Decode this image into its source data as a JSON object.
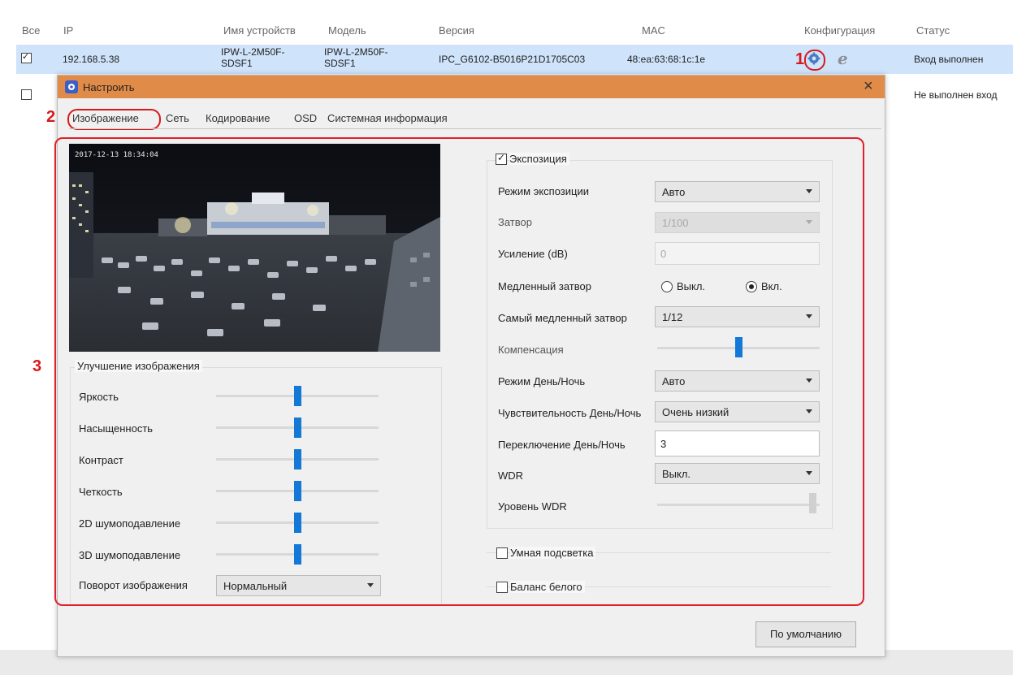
{
  "table": {
    "headers": {
      "all": "Все",
      "ip": "IP",
      "device_name": "Имя устройств",
      "model": "Модель",
      "version": "Версия",
      "mac": "MAC",
      "config": "Конфигурация",
      "status": "Статус"
    },
    "rows": [
      {
        "checked": true,
        "ip": "192.168.5.38",
        "device_name_1": "IPW-L-2M50F-",
        "device_name_2": "SDSF1",
        "model_1": "IPW-L-2M50F-",
        "model_2": "SDSF1",
        "version": "IPC_G6102-B5016P21D1705C03",
        "mac": "48:ea:63:68:1c:1e",
        "status": "Вход выполнен"
      },
      {
        "checked": false,
        "status": "Не выполнен вход"
      }
    ]
  },
  "annotations": {
    "n1": "1",
    "n2": "2",
    "n3": "3"
  },
  "dialog": {
    "title": "Настроить",
    "tabs": [
      "Изображение",
      "Сеть",
      "Кодирование",
      "OSD",
      "Системная информация"
    ],
    "osd_time": "2017-12-13 18:34:04",
    "enhancement": {
      "title": "Улучшение изображения",
      "items": [
        {
          "label": "Яркость",
          "value": 0.5
        },
        {
          "label": "Насыщенность",
          "value": 0.5
        },
        {
          "label": "Контраст",
          "value": 0.5
        },
        {
          "label": "Четкость",
          "value": 0.5
        },
        {
          "label": "2D шумоподавление",
          "value": 0.5
        },
        {
          "label": "3D шумоподавление",
          "value": 0.5
        }
      ],
      "rotation_label": "Поворот изображения",
      "rotation_value": "Нормальный"
    },
    "exposure": {
      "title": "Экспозиция",
      "checked": true,
      "mode_label": "Режим экспозиции",
      "mode_value": "Авто",
      "shutter_label": "Затвор",
      "shutter_value": "1/100",
      "gain_label": "Усиление (dB)",
      "gain_value": "0",
      "slow_shutter_label": "Медленный затвор",
      "slow_off": "Выкл.",
      "slow_on": "Вкл.",
      "slowest_label": "Самый медленный затвор",
      "slowest_value": "1/12",
      "compensation_label": "Компенсация",
      "compensation_value": 0.5,
      "daynight_mode_label": "Режим День/Ночь",
      "daynight_mode_value": "Авто",
      "daynight_sens_label": "Чувствительность День/Ночь",
      "daynight_sens_value": "Очень низкий",
      "daynight_switch_label": "Переключение День/Ночь",
      "daynight_switch_value": "3",
      "wdr_label": "WDR",
      "wdr_value": "Выкл.",
      "wdr_level_label": "Уровень WDR",
      "wdr_level_value": 1.0
    },
    "smart_ir": "Умная подсветка",
    "white_balance": "Баланс белого",
    "default_button": "По умолчанию"
  },
  "colors": {
    "titlebar": "#e08b48",
    "selected_row": "#cfe3fb",
    "slider_thumb": "#1478d6",
    "annotation": "#d61a1a"
  }
}
